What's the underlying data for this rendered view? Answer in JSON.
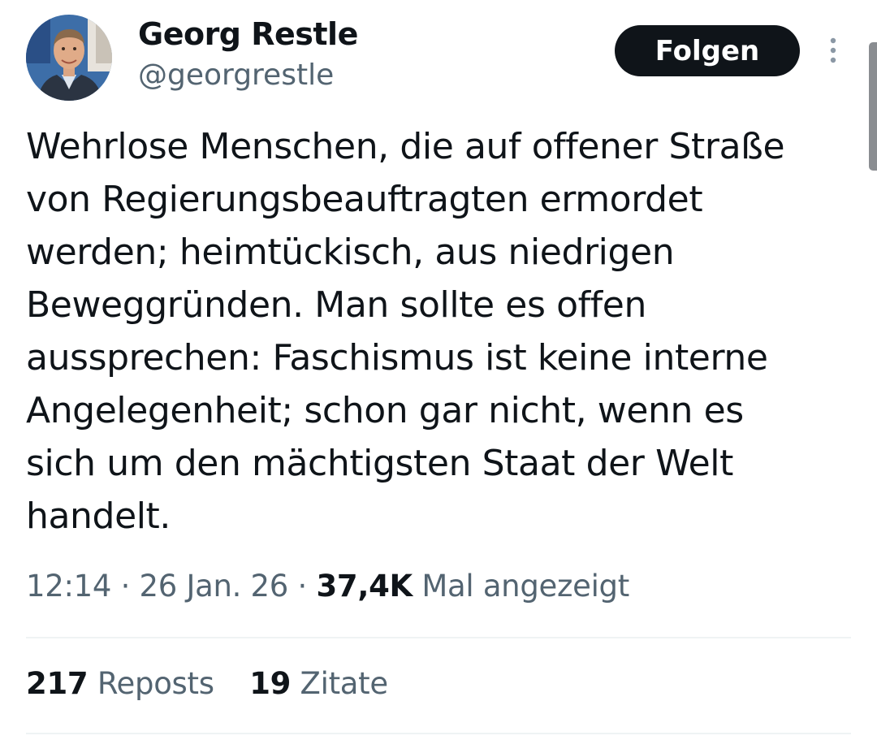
{
  "author": {
    "display_name": "Georg Restle",
    "handle": "@georgrestle"
  },
  "follow_button_label": "Folgen",
  "more_icon": "more-vertical-icon",
  "tweet": {
    "lines": [
      "Wehrlose Menschen, die auf offener Straße",
      "von Regierungsbeauftragten ermordet",
      "werden; heimtückisch, aus niedrigen",
      "Beweggründen. Man sollte es offen",
      "aussprechen: Faschismus ist keine interne",
      "Angelegenheit; schon gar nicht, wenn es",
      "sich um den mächtigsten Staat der Welt",
      "handelt."
    ]
  },
  "meta": {
    "time": "12:14",
    "separator": "·",
    "date": "26 Jan. 26",
    "views_count": "37,4K",
    "views_label": "Mal angezeigt"
  },
  "stats": {
    "reposts_count": "217",
    "reposts_label": "Reposts",
    "quotes_count": "19",
    "quotes_label": "Zitate"
  },
  "colors": {
    "text_primary": "#0f1419",
    "text_secondary": "#536471",
    "button_bg": "#0f1419",
    "divider": "#eff3f4"
  }
}
